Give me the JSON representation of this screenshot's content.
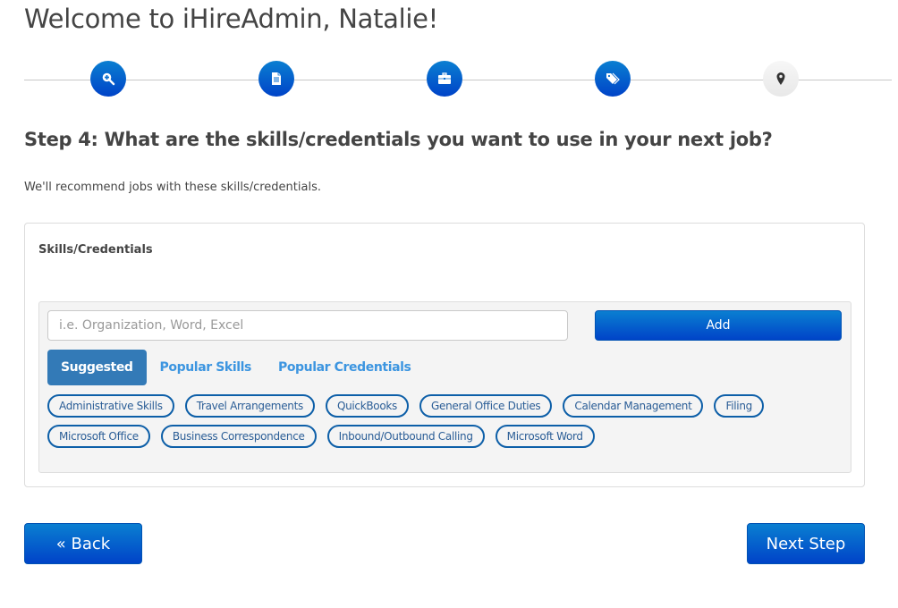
{
  "header": {
    "title": "Welcome to iHireAdmin, Natalie!"
  },
  "progress": {
    "steps": [
      {
        "name": "search",
        "icon": "search-plus-icon",
        "state": "complete"
      },
      {
        "name": "resume",
        "icon": "document-icon",
        "state": "complete"
      },
      {
        "name": "job",
        "icon": "briefcase-icon",
        "state": "complete"
      },
      {
        "name": "skills",
        "icon": "tags-icon",
        "state": "current"
      },
      {
        "name": "location",
        "icon": "map-marker-icon",
        "state": "upcoming"
      }
    ]
  },
  "step": {
    "number_label": "Step 4:",
    "question": " What are the skills/credentials you want to use in your next job?",
    "subtitle": "We'll recommend jobs with these skills/credentials."
  },
  "panel": {
    "label": "Skills/Credentials",
    "input": {
      "value": "",
      "placeholder": "i.e. Organization, Word, Excel"
    },
    "add_label": "Add",
    "tabs": [
      {
        "label": "Suggested",
        "active": true
      },
      {
        "label": "Popular Skills",
        "active": false
      },
      {
        "label": "Popular Credentials",
        "active": false
      }
    ],
    "chips": [
      "Administrative Skills",
      "Travel Arrangements",
      "QuickBooks",
      "General Office Duties",
      "Calendar Management",
      "Filing",
      "Microsoft Office",
      "Business Correspondence",
      "Inbound/Outbound Calling",
      "Microsoft Word"
    ]
  },
  "footer": {
    "back_label": "« Back",
    "next_label": "Next Step"
  },
  "colors": {
    "primary_top": "#0a7fd1",
    "primary_bottom": "#0043c8",
    "tab_active": "#337ab7",
    "tab_link": "#3c95e0",
    "chip_border": "#0d5fa8"
  }
}
